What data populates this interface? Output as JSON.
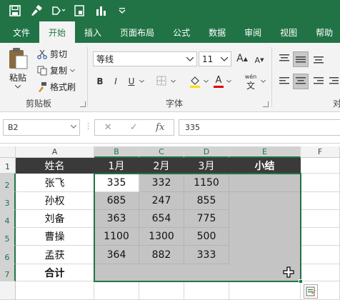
{
  "tabs": [
    "文件",
    "开始",
    "插入",
    "页面布局",
    "公式",
    "数据",
    "审阅",
    "视图",
    "帮助"
  ],
  "active_tab": "开始",
  "clipboard": {
    "paste": "粘贴",
    "cut": "剪切",
    "copy": "复制",
    "format_painter": "格式刷",
    "group_label": "剪贴板"
  },
  "font": {
    "name": "等线",
    "size": "11",
    "grow": "A",
    "shrink": "A",
    "bold": "B",
    "italic": "I",
    "underline": "U",
    "font_color": "A",
    "phonetic_top": "wén",
    "phonetic_bottom": "文",
    "group_label": "字体"
  },
  "alignment": {
    "group_label_partial": "对"
  },
  "name_box": "B2",
  "formula_bar": {
    "cancel": "✕",
    "enter": "✓",
    "fx": "fx",
    "value": "335"
  },
  "columns": [
    "A",
    "B",
    "C",
    "D",
    "E",
    "F"
  ],
  "rows": [
    "1",
    "2",
    "3",
    "4",
    "5",
    "6",
    "7"
  ],
  "table": {
    "headers": [
      "姓名",
      "1月",
      "2月",
      "3月",
      "小结"
    ],
    "names": [
      "张飞",
      "孙权",
      "刘备",
      "曹操",
      "孟获"
    ],
    "values": [
      [
        "335",
        "332",
        "1150"
      ],
      [
        "685",
        "247",
        "855"
      ],
      [
        "363",
        "654",
        "775"
      ],
      [
        "1100",
        "1300",
        "500"
      ],
      [
        "364",
        "882",
        "333"
      ]
    ],
    "total_label": "合计"
  },
  "colors": {
    "excel_green": "#217346",
    "header_fill": "#3a3a3a",
    "selection_fill": "#c4c4c4"
  }
}
